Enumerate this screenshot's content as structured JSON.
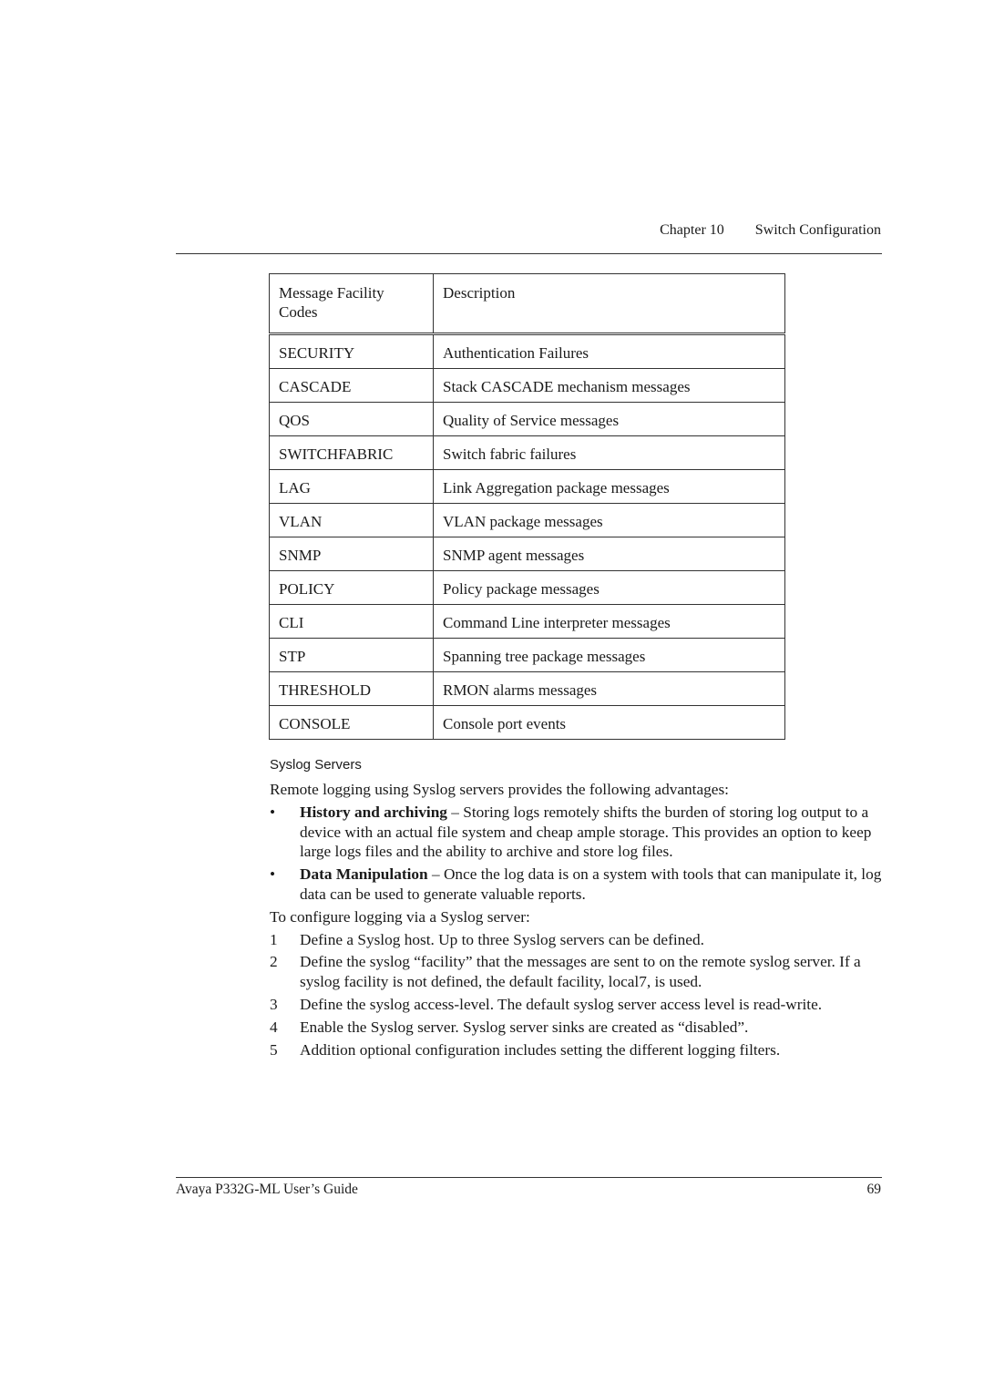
{
  "header": {
    "chapter": "Chapter 10",
    "title": "Switch Configuration"
  },
  "table": {
    "headers": [
      "Message Facility Codes",
      "Description"
    ],
    "rows": [
      [
        "SECURITY",
        "Authentication Failures"
      ],
      [
        "CASCADE",
        "Stack CASCADE mechanism messages"
      ],
      [
        "QOS",
        "Quality of Service messages"
      ],
      [
        "SWITCHFABRIC",
        "Switch fabric failures"
      ],
      [
        "LAG",
        "Link Aggregation package messages"
      ],
      [
        "VLAN",
        "VLAN package messages"
      ],
      [
        "SNMP",
        "SNMP agent messages"
      ],
      [
        "POLICY",
        "Policy package messages"
      ],
      [
        "CLI",
        "Command Line interpreter messages"
      ],
      [
        "STP",
        "Spanning tree package messages"
      ],
      [
        "THRESHOLD",
        "RMON alarms messages"
      ],
      [
        "CONSOLE",
        "Console port events"
      ]
    ]
  },
  "section": {
    "title": "Syslog Servers",
    "intro": "Remote logging using Syslog servers provides the following advantages:",
    "bullets": [
      {
        "mark": "•",
        "bold": "History and archiving",
        "text": " – Storing logs remotely shifts the burden of storing log output to a device with an actual file system and cheap ample storage. This provides an option to keep large logs files and the ability to archive and store log files."
      },
      {
        "mark": "•",
        "bold": "Data Manipulation",
        "text": " – Once the log data is on a system with tools that can manipulate it, log data can be used to generate valuable reports."
      }
    ],
    "steps_intro": "To configure logging via a Syslog server:",
    "steps": [
      {
        "num": "1",
        "text": "Define a Syslog host. Up to three Syslog servers can be defined."
      },
      {
        "num": "2",
        "text": "Define the syslog “facility” that the messages are sent to on the remote syslog server. If a syslog facility is not defined, the default facility, local7, is used."
      },
      {
        "num": "3",
        "text": "Define the syslog access-level. The default syslog server access level is read-write."
      },
      {
        "num": "4",
        "text": "Enable the Syslog server. Syslog server sinks are created as “disabled”."
      },
      {
        "num": "5",
        "text": "Addition optional configuration includes setting the different logging filters."
      }
    ]
  },
  "footer": {
    "guide": "Avaya P332G-ML User’s Guide",
    "page": "69"
  }
}
